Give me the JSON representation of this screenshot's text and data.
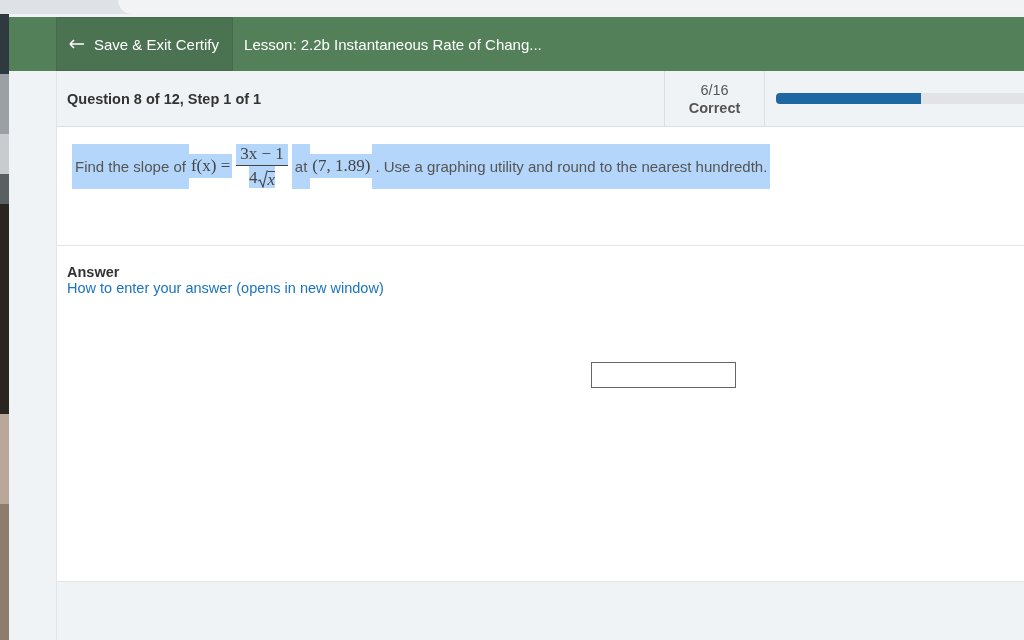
{
  "header": {
    "exit_button": "Save & Exit Certify",
    "lesson_title": "Lesson: 2.2b Instantaneous Rate of Chang..."
  },
  "question_bar": {
    "title": "Question 8 of 12, Step 1 of 1",
    "score": "6/16",
    "score_label": "Correct",
    "level": 0.375
  },
  "question": {
    "lead": "Find the slope of",
    "function": "f(x) =",
    "numerator": "3x − 1",
    "denominator_coef": "4",
    "radicand": "x",
    "at": "at",
    "point": "(7, 1.89)",
    "tail": ". Use a graphing utility and round to the nearest hundredth.",
    "selected": true
  },
  "answer": {
    "label": "Answer",
    "help_link": "How to enter your answer (opens in new window)"
  }
}
